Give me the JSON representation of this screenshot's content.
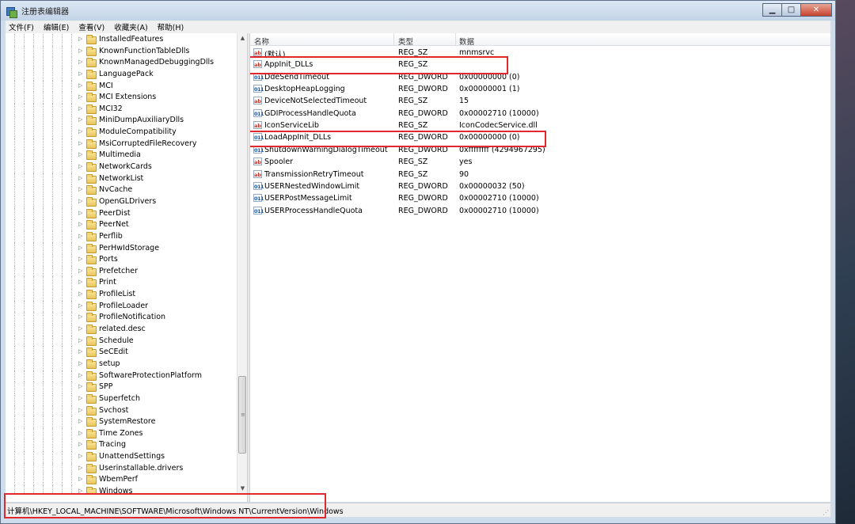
{
  "window": {
    "title": "注册表编辑器",
    "controls": {
      "minimize": "▁",
      "maximize": "□",
      "close": "✕"
    }
  },
  "menu": [
    "文件(F)",
    "编辑(E)",
    "查看(V)",
    "收藏夹(A)",
    "帮助(H)"
  ],
  "tree": {
    "items": [
      "InstalledFeatures",
      "KnownFunctionTableDlls",
      "KnownManagedDebuggingDlls",
      "LanguagePack",
      "MCI",
      "MCI Extensions",
      "MCI32",
      "MiniDumpAuxiliaryDlls",
      "ModuleCompatibility",
      "MsiCorruptedFileRecovery",
      "Multimedia",
      "NetworkCards",
      "NetworkList",
      "NvCache",
      "OpenGLDrivers",
      "PeerDist",
      "PeerNet",
      "Perflib",
      "PerHwIdStorage",
      "Ports",
      "Prefetcher",
      "Print",
      "ProfileList",
      "ProfileLoader",
      "ProfileNotification",
      "related.desc",
      "Schedule",
      "SeCEdit",
      "setup",
      "SoftwareProtectionPlatform",
      "SPP",
      "Superfetch",
      "Svchost",
      "SystemRestore",
      "Time Zones",
      "Tracing",
      "UnattendSettings",
      "Userinstallable.drivers",
      "WbemPerf",
      "Windows"
    ]
  },
  "values": {
    "headers": {
      "name": "名称",
      "type": "类型",
      "data": "数据"
    },
    "rows": [
      {
        "name": "(默认)",
        "type": "REG_SZ",
        "data": "mnmsrvc",
        "icon": "sz"
      },
      {
        "name": "AppInit_DLLs",
        "type": "REG_SZ",
        "data": "",
        "icon": "sz"
      },
      {
        "name": "DdeSendTimeout",
        "type": "REG_DWORD",
        "data": "0x00000000 (0)",
        "icon": "dw"
      },
      {
        "name": "DesktopHeapLogging",
        "type": "REG_DWORD",
        "data": "0x00000001 (1)",
        "icon": "dw"
      },
      {
        "name": "DeviceNotSelectedTimeout",
        "type": "REG_SZ",
        "data": "15",
        "icon": "sz"
      },
      {
        "name": "GDIProcessHandleQuota",
        "type": "REG_DWORD",
        "data": "0x00002710 (10000)",
        "icon": "dw"
      },
      {
        "name": "IconServiceLib",
        "type": "REG_SZ",
        "data": "IconCodecService.dll",
        "icon": "sz"
      },
      {
        "name": "LoadAppInit_DLLs",
        "type": "REG_DWORD",
        "data": "0x00000000 (0)",
        "icon": "dw"
      },
      {
        "name": "ShutdownWarningDialogTimeout",
        "type": "REG_DWORD",
        "data": "0xffffffff (4294967295)",
        "icon": "dw"
      },
      {
        "name": "Spooler",
        "type": "REG_SZ",
        "data": "yes",
        "icon": "sz"
      },
      {
        "name": "TransmissionRetryTimeout",
        "type": "REG_SZ",
        "data": "90",
        "icon": "sz"
      },
      {
        "name": "USERNestedWindowLimit",
        "type": "REG_DWORD",
        "data": "0x00000032 (50)",
        "icon": "dw"
      },
      {
        "name": "USERPostMessageLimit",
        "type": "REG_DWORD",
        "data": "0x00002710 (10000)",
        "icon": "dw"
      },
      {
        "name": "USERProcessHandleQuota",
        "type": "REG_DWORD",
        "data": "0x00002710 (10000)",
        "icon": "dw"
      }
    ]
  },
  "icons": {
    "string_value": "ab",
    "dword_value": "011"
  },
  "status": {
    "path": "计算机\\HKEY_LOCAL_MACHINE\\SOFTWARE\\Microsoft\\Windows NT\\CurrentVersion\\Windows"
  },
  "colors": {
    "highlight": "#e0282e",
    "accent": "#1f5aa6"
  }
}
